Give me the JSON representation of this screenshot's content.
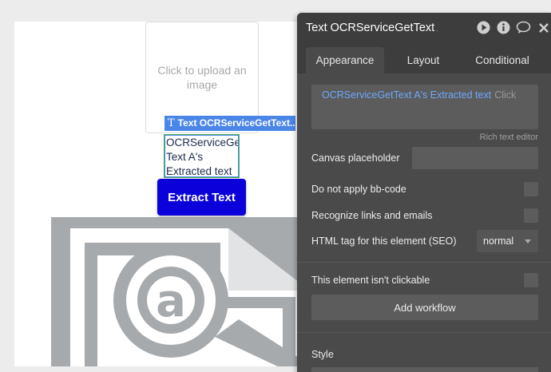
{
  "canvas": {
    "uploader_text": "Click to upload an image",
    "selection_tag": "Text OCRServiceGetText...",
    "text_element": "OCRServiceGet Text A's Extracted text",
    "extract_button": "Extract Text"
  },
  "panel": {
    "title": "Text OCRServiceGetText A",
    "tabs": [
      {
        "label": "Appearance"
      },
      {
        "label": "Layout"
      },
      {
        "label": "Conditional"
      }
    ],
    "rich_text": {
      "dynamic_value": "OCRServiceGetText A's Extracted text",
      "hint": "Click",
      "editor_link": "Rich text editor"
    },
    "canvas_placeholder_label": "Canvas placeholder",
    "bbcode_label": "Do not apply bb-code",
    "links_label": "Recognize links and emails",
    "html_tag_label": "HTML tag for this element (SEO)",
    "html_tag_value": "normal",
    "not_clickable_label": "This element isn't clickable",
    "add_workflow_label": "Add workflow",
    "style_label": "Style"
  },
  "colors": {
    "button_blue": "#0b00d9",
    "selection_blue": "#4a86e8",
    "panel_bg": "#4a4a4a",
    "dynamic_text": "#6ea8ff"
  }
}
